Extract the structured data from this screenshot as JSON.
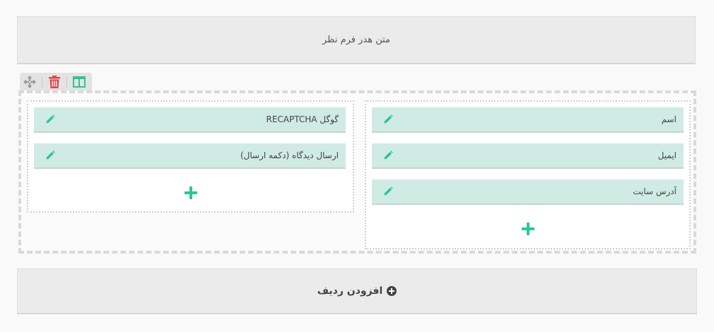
{
  "header": {
    "text": "متن هدر فرم نظر"
  },
  "toolbar": {
    "icons": [
      "move-icon",
      "trash-icon",
      "columns-layout-icon"
    ]
  },
  "columns": {
    "right": {
      "fields": [
        {
          "label": "اسم"
        },
        {
          "label": "ایمیل"
        },
        {
          "label": "آدرس سایت"
        }
      ]
    },
    "left": {
      "fields": [
        {
          "label": "گوگل RECAPTCHA"
        },
        {
          "label": "ارسال دیدگاه (دکمه ارسال)"
        }
      ]
    }
  },
  "add_row": {
    "label": "افزودن ردیف"
  },
  "colors": {
    "field_bg": "#d0ebe4",
    "accent": "#2ec49b",
    "delete": "#e2474c"
  }
}
